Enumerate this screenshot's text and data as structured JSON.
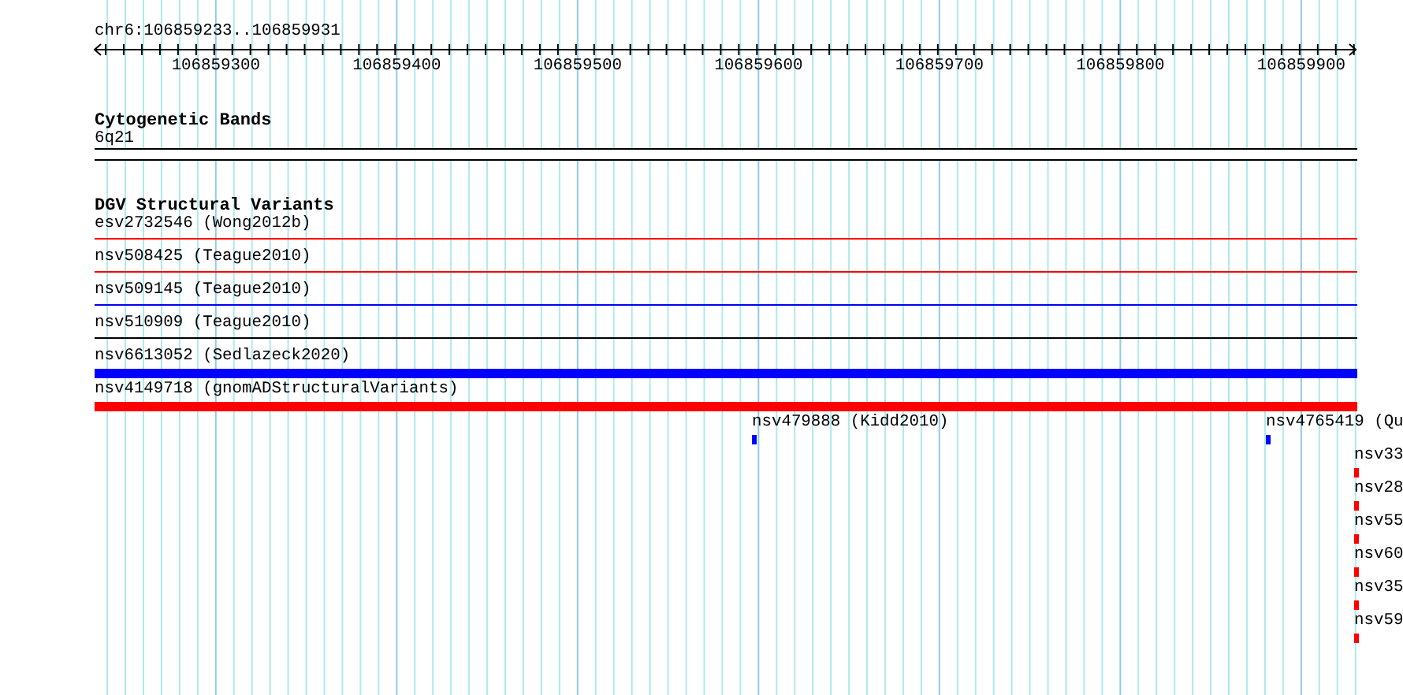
{
  "ruler": {
    "location": "chr6:106859233..106859931",
    "labels": [
      "106859300",
      "106859400",
      "106859500",
      "106859600",
      "106859700",
      "106859800",
      "106859900"
    ]
  },
  "tracks": [
    {
      "title": "Cytogenetic Bands",
      "features": [
        {
          "label": "6q21",
          "kind": "band",
          "color": "#ffffff"
        }
      ]
    },
    {
      "title": "DGV Structural Variants",
      "features": [
        {
          "label": "esv2732546 (Wong2012b)",
          "kind": "line",
          "color": "#ff0000"
        },
        {
          "label": "nsv508425 (Teague2010)",
          "kind": "line",
          "color": "#ff0000"
        },
        {
          "label": "nsv509145 (Teague2010)",
          "kind": "line",
          "color": "#0000ff"
        },
        {
          "label": "nsv510909 (Teague2010)",
          "kind": "line",
          "color": "#000000"
        },
        {
          "label": "nsv6613052 (Sedlazeck2020)",
          "kind": "bar",
          "color": "#0000ff"
        },
        {
          "label": "nsv4149718 (gnomADStructuralVariants)",
          "kind": "bar",
          "color": "#ff0000"
        },
        {
          "label": "nsv479888 (Kidd2010)",
          "kind": "tick",
          "color": "#0000ff"
        },
        {
          "label": "nsv4765419 (Qu",
          "kind": "tick",
          "color": "#0000ff"
        },
        {
          "label": "nsv33",
          "kind": "tick",
          "color": "#ff0000"
        },
        {
          "label": "nsv28",
          "kind": "tick",
          "color": "#ff0000"
        },
        {
          "label": "nsv55",
          "kind": "tick",
          "color": "#ff0000"
        },
        {
          "label": "nsv60",
          "kind": "tick",
          "color": "#ff0000"
        },
        {
          "label": "nsv35",
          "kind": "tick",
          "color": "#ff0000"
        },
        {
          "label": "nsv59",
          "kind": "tick",
          "color": "#ff0000"
        }
      ]
    }
  ]
}
